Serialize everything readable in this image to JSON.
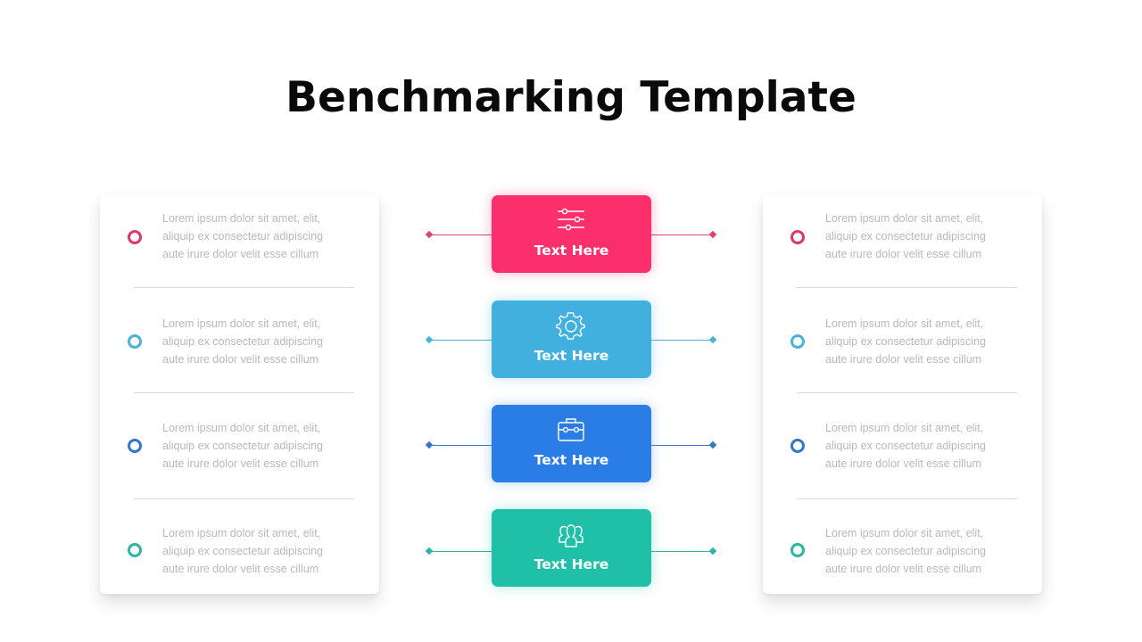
{
  "title": "Benchmarking Template",
  "colors": {
    "pink": "#fb2f6b",
    "sky": "#41b0de",
    "blue": "#2b7de6",
    "teal": "#1fbfa8"
  },
  "cards": [
    {
      "label": "Text Here",
      "icon": "sliders-icon"
    },
    {
      "label": "Text Here",
      "icon": "gear-icon"
    },
    {
      "label": "Text Here",
      "icon": "briefcase-icon"
    },
    {
      "label": "Text Here",
      "icon": "users-icon"
    }
  ],
  "left_panel": {
    "items": [
      {
        "lines": [
          "Lorem ipsum dolor  sit amet, elit,",
          "aliquip ex consectetur  adipiscing",
          "aute irure dolor  velit esse cillum"
        ]
      },
      {
        "lines": [
          "Lorem ipsum dolor  sit amet, elit,",
          "aliquip ex consectetur  adipiscing",
          "aute irure dolor  velit esse cillum"
        ]
      },
      {
        "lines": [
          "Lorem ipsum dolor  sit amet, elit,",
          "aliquip ex consectetur  adipiscing",
          "aute irure dolor  velit esse cillum"
        ]
      },
      {
        "lines": [
          "Lorem ipsum dolor  sit amet, elit,",
          "aliquip ex consectetur  adipiscing",
          "aute irure dolor  velit esse cillum"
        ]
      }
    ]
  },
  "right_panel": {
    "items": [
      {
        "lines": [
          "Lorem ipsum dolor  sit amet, elit,",
          "aliquip ex consectetur  adipiscing",
          "aute irure dolor  velit esse cillum"
        ]
      },
      {
        "lines": [
          "Lorem ipsum dolor  sit amet, elit,",
          "aliquip ex consectetur  adipiscing",
          "aute irure dolor  velit esse cillum"
        ]
      },
      {
        "lines": [
          "Lorem ipsum dolor  sit amet, elit,",
          "aliquip ex consectetur  adipiscing",
          "aute irure dolor  velit esse cillum"
        ]
      },
      {
        "lines": [
          "Lorem ipsum dolor  sit amet, elit,",
          "aliquip ex consectetur  adipiscing",
          "aute irure dolor  velit esse cillum"
        ]
      }
    ]
  }
}
